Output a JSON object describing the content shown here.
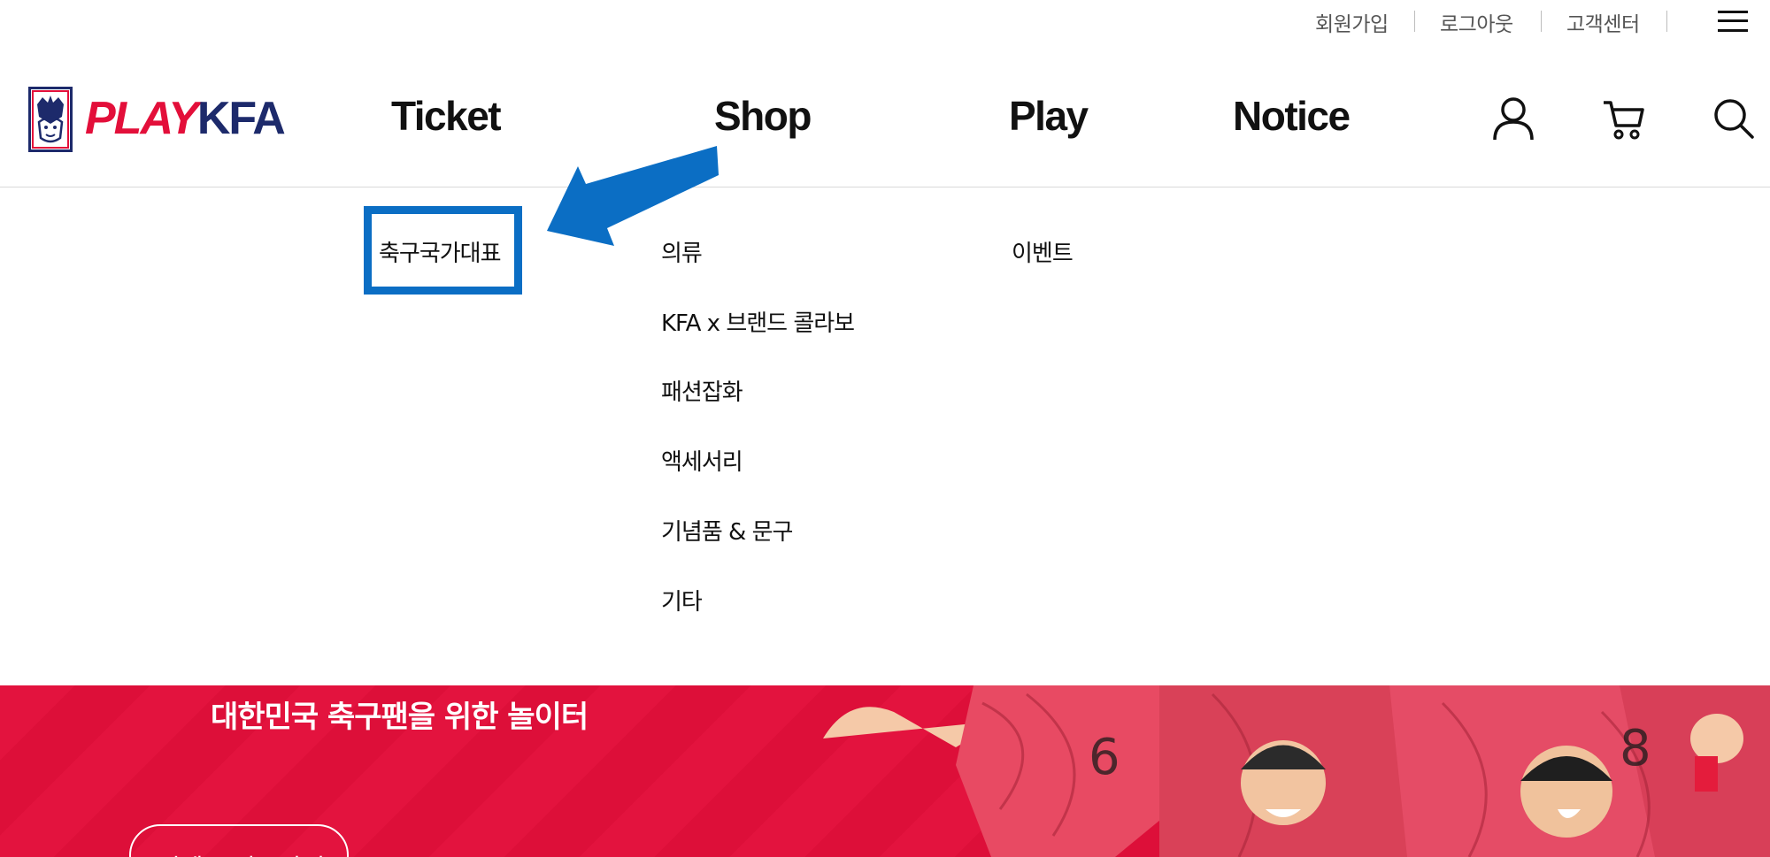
{
  "utility_nav": {
    "signup": "회원가입",
    "logout": "로그아웃",
    "support": "고객센터"
  },
  "logo": {
    "play": "PLAY",
    "kfa": "KFA"
  },
  "main_nav": {
    "ticket": "Ticket",
    "shop": "Shop",
    "play": "Play",
    "notice": "Notice"
  },
  "dropdown": {
    "ticket": [
      "축구국가대표"
    ],
    "shop": [
      "의류",
      "KFA x 브랜드 콜라보",
      "패션잡화",
      "액세서리",
      "기념품 & 문구",
      "기타"
    ],
    "play": [
      "이벤트"
    ]
  },
  "banner": {
    "title": "대한민국 축구팬을 위한 놀이터",
    "button": "이벤트 바로가기"
  },
  "colors": {
    "brand_red": "#e30f3a",
    "brand_navy": "#1d2a6b",
    "annotation_blue": "#0b6ec4"
  },
  "icons": [
    "hamburger-menu-icon",
    "user-icon",
    "cart-icon",
    "search-icon",
    "annotation-arrow-icon"
  ]
}
